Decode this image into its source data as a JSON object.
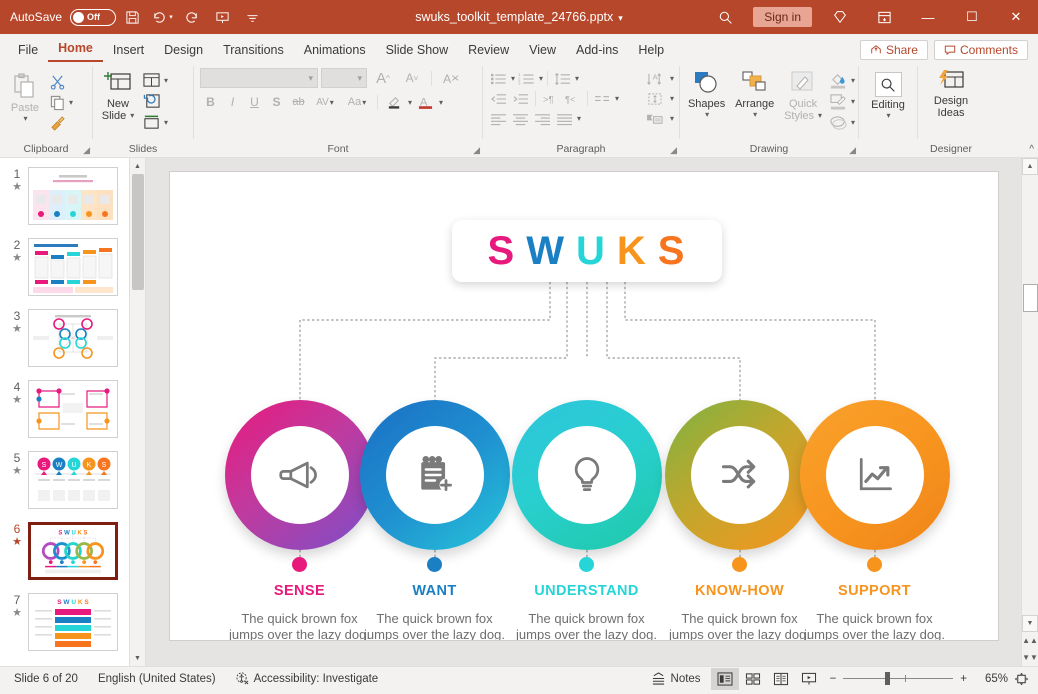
{
  "titlebar": {
    "autosave_label": "AutoSave",
    "autosave_state": "Off",
    "save_icon": "save-icon",
    "undo_icon": "undo-icon",
    "redo_icon": "redo-icon",
    "present_icon": "start-presentation-icon",
    "customize_icon": "customize-quick-access-icon",
    "filename": "swuks_toolkit_template_24766.pptx",
    "filename_caret": "▾",
    "search_icon": "search-icon",
    "signin_label": "Sign in",
    "diamond_icon": "diamond-icon",
    "ribbon_display_icon": "ribbon-display-options-icon",
    "minimize": "—",
    "maximize": "☐",
    "close": "✕"
  },
  "tabs": {
    "items": [
      {
        "label": "File"
      },
      {
        "label": "Home"
      },
      {
        "label": "Insert"
      },
      {
        "label": "Design"
      },
      {
        "label": "Transitions"
      },
      {
        "label": "Animations"
      },
      {
        "label": "Slide Show"
      },
      {
        "label": "Review"
      },
      {
        "label": "View"
      },
      {
        "label": "Add-ins"
      },
      {
        "label": "Help"
      }
    ],
    "active_index": 1,
    "share_label": "Share",
    "comments_label": "Comments"
  },
  "ribbon": {
    "clipboard": {
      "name": "Clipboard",
      "paste_label": "Paste",
      "cut_label": "Cut",
      "copy_label": "Copy",
      "format_painter_label": "Format Painter"
    },
    "slides": {
      "name": "Slides",
      "new_slide_label": "New\nSlide",
      "new_slide_line1": "New",
      "new_slide_line2": "Slide",
      "layout_label": "Layout",
      "reset_label": "Reset",
      "section_label": "Section"
    },
    "font": {
      "name": "Font",
      "font_name_value": "",
      "font_name_placeholder": "",
      "font_size_value": "",
      "font_size_placeholder": "",
      "bold": "B",
      "italic": "I",
      "underline": "U",
      "shadow": "S",
      "strikethrough": "ab",
      "char_spacing": "AV",
      "change_case": "Aa",
      "grow_font": "A",
      "shrink_font": "A",
      "clear_formatting": "A"
    },
    "paragraph": {
      "name": "Paragraph"
    },
    "drawing": {
      "name": "Drawing",
      "shapes_label": "Shapes",
      "arrange_label": "Arrange",
      "quick_styles_line1": "Quick",
      "quick_styles_line2": "Styles"
    },
    "editing": {
      "name": "",
      "editing_label": "Editing"
    },
    "designer": {
      "name": "Designer",
      "design_ideas_line1": "Design",
      "design_ideas_line2": "Ideas"
    },
    "collapse_icon": "collapse-ribbon-icon"
  },
  "thumbnails": {
    "selected": 6,
    "items": [
      {
        "num": "1",
        "star": "★"
      },
      {
        "num": "2",
        "star": "★"
      },
      {
        "num": "3",
        "star": "★"
      },
      {
        "num": "4",
        "star": "★"
      },
      {
        "num": "5",
        "star": "★"
      },
      {
        "num": "6",
        "star": "★"
      },
      {
        "num": "7",
        "star": "★"
      }
    ]
  },
  "slide": {
    "title_letters": [
      {
        "char": "S",
        "color": "#e8197d"
      },
      {
        "char": "W",
        "color": "#1b7fc4"
      },
      {
        "char": "U",
        "color": "#26d5d8"
      },
      {
        "char": "K",
        "color": "#f7941e"
      },
      {
        "char": "S",
        "color": "#f7751e"
      }
    ],
    "items": [
      {
        "label": "SENSE",
        "body": "The quick brown fox jumps over the lazy dog.",
        "icon": "megaphone-icon",
        "dot_color": "#e8197d",
        "label_color": "#e8197d",
        "grad_from": "#e8197d",
        "grad_to": "#7b4fc9"
      },
      {
        "label": "WANT",
        "body": "The quick brown fox jumps over the lazy dog.",
        "icon": "notepad-add-icon",
        "dot_color": "#1b7fc4",
        "label_color": "#1b7fc4",
        "grad_from": "#1b6fc4",
        "grad_to": "#27c6d9"
      },
      {
        "label": "UNDERSTAND",
        "body": "The quick brown fox jumps over the lazy dog.",
        "icon": "lightbulb-icon",
        "dot_color": "#26d5d8",
        "label_color": "#26d5d8",
        "grad_from": "#29c9d6",
        "grad_to": "#1fc9a8"
      },
      {
        "label": "KNOW-HOW",
        "body": "The quick brown fox jumps over the lazy dog.",
        "icon": "shuffle-icon",
        "dot_color": "#f7941e",
        "label_color": "#f7941e",
        "grad_from": "#7cb342",
        "grad_to": "#f7941e"
      },
      {
        "label": "SUPPORT",
        "body": "The quick brown fox jumps over the lazy dog.",
        "icon": "chart-trend-up-icon",
        "dot_color": "#f7941e",
        "label_color": "#f7941e",
        "grad_from": "#f7941e",
        "grad_to": "#f7941e"
      }
    ]
  },
  "status": {
    "slide_count": "Slide 6 of 20",
    "language": "English (United States)",
    "accessibility_icon": "accessibility-icon",
    "accessibility": "Accessibility: Investigate",
    "notes_label": "Notes",
    "notes_icon": "notes-icon",
    "view_normal": "normal-view-icon",
    "view_sorter": "slide-sorter-icon",
    "view_reading": "reading-view-icon",
    "view_show": "slide-show-icon",
    "zoom_out": "−",
    "zoom_in": "+",
    "zoom_value": "65%",
    "fit_icon": "fit-to-window-icon"
  }
}
